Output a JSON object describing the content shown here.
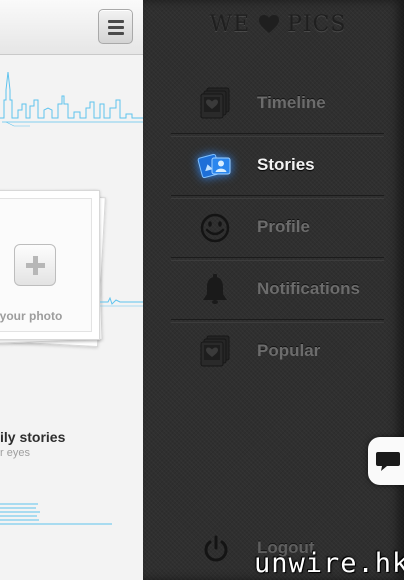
{
  "brand": {
    "left": "WE",
    "right": "PICS",
    "heart_icon": "heart-icon"
  },
  "menu": {
    "items": [
      {
        "label": "Timeline",
        "icon": "photo-stack-heart-icon",
        "active": false
      },
      {
        "label": "Stories",
        "icon": "stories-cards-icon",
        "active": true
      },
      {
        "label": "Profile",
        "icon": "smiley-face-icon",
        "active": false
      },
      {
        "label": "Notifications",
        "icon": "bell-icon",
        "active": false
      },
      {
        "label": "Popular",
        "icon": "photo-stack-heart-icon",
        "active": false
      }
    ],
    "logout": {
      "label": "Logout",
      "icon": "power-icon"
    }
  },
  "left_panel": {
    "menu_button_icon": "hamburger-icon",
    "add_photo_text": "l your photo",
    "story_title": "ily stories",
    "story_subtitle": "r eyes"
  },
  "chat_icon": "chat-bubble-icon",
  "watermark": "unwire.hk",
  "colors": {
    "accent": "#3a9bff",
    "menu_bg": "#2f2f2f",
    "label_inactive": "#6c6c6c",
    "label_active": "#f3f3f3",
    "skyline": "#5ec3ee"
  }
}
